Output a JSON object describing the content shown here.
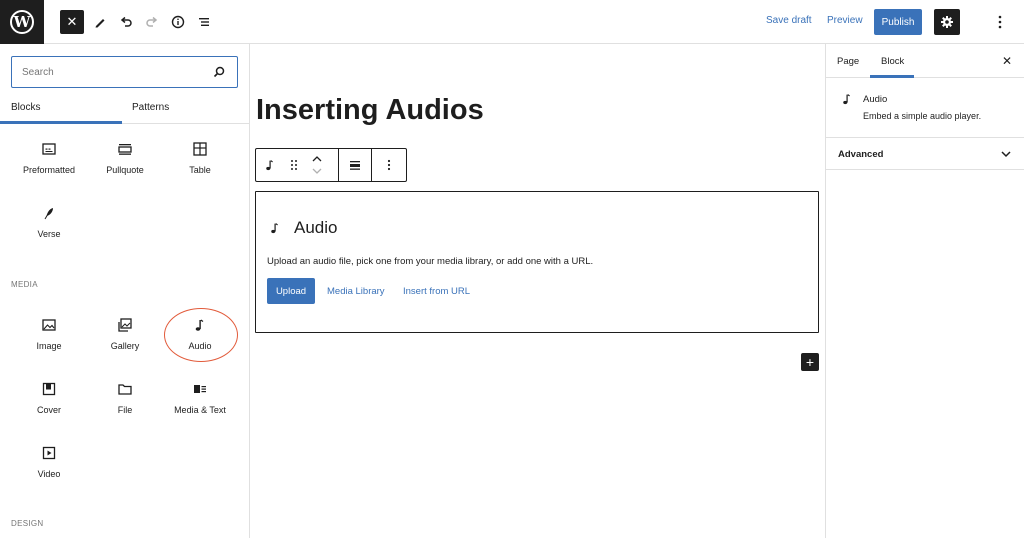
{
  "app": {
    "logo": "W"
  },
  "header": {
    "close_label": "✕",
    "save_draft": "Save draft",
    "preview": "Preview",
    "publish": "Publish"
  },
  "inserter": {
    "search_placeholder": "Search",
    "tabs": [
      "Blocks",
      "Patterns"
    ],
    "text_blocks": [
      {
        "label": "Preformatted",
        "icon": "preformatted-icon"
      },
      {
        "label": "Pullquote",
        "icon": "pullquote-icon"
      },
      {
        "label": "Table",
        "icon": "table-icon"
      },
      {
        "label": "Verse",
        "icon": "verse-icon"
      }
    ],
    "media_heading": "MEDIA",
    "media_blocks": [
      {
        "label": "Image",
        "icon": "image-icon"
      },
      {
        "label": "Gallery",
        "icon": "gallery-icon"
      },
      {
        "label": "Audio",
        "icon": "audio-icon"
      },
      {
        "label": "Cover",
        "icon": "cover-icon"
      },
      {
        "label": "File",
        "icon": "file-icon"
      },
      {
        "label": "Media & Text",
        "icon": "media-text-icon"
      },
      {
        "label": "Video",
        "icon": "video-icon"
      }
    ],
    "design_heading": "DESIGN"
  },
  "editor": {
    "post_title": "Inserting Audios",
    "audio_block": {
      "title": "Audio",
      "description": "Upload an audio file, pick one from your media library, or add one with a URL.",
      "upload": "Upload",
      "media_library": "Media Library",
      "insert_url": "Insert from URL"
    },
    "add_block": "+"
  },
  "sidebar": {
    "tabs": [
      "Page",
      "Block"
    ],
    "close": "✕",
    "block_card": {
      "title": "Audio",
      "description": "Embed a simple audio player."
    },
    "advanced": "Advanced"
  },
  "colors": {
    "accent": "#3a72b9",
    "dark": "#1e1e1e",
    "border": "#e0e0e0",
    "highlight_ring": "#e25b3b"
  }
}
